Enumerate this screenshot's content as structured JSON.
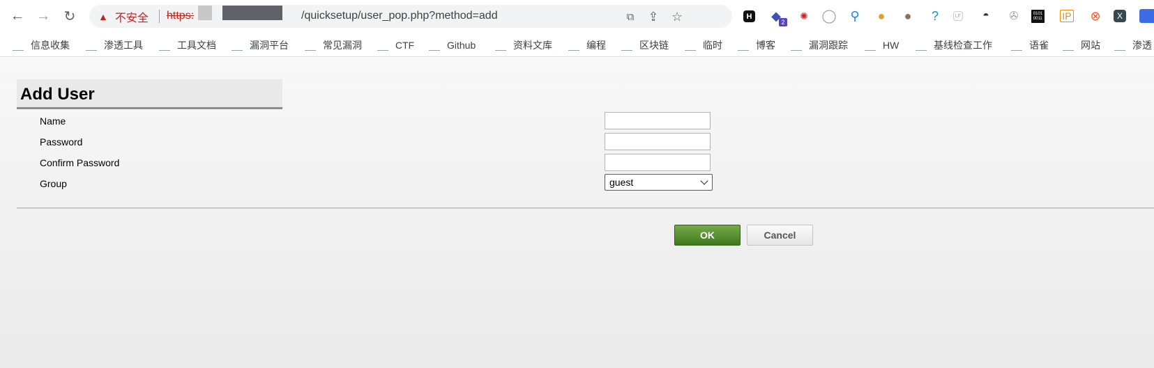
{
  "browser": {
    "security_warning": "不安全",
    "url_scheme": "https:",
    "url_path": "/quicksetup/user_pop.php?method=add",
    "extensions": {
      "hackbar": "H",
      "badge_count": "2",
      "binary_label": "0101\n0011",
      "lf_label": "LF",
      "ip_label": "IP",
      "x_label": "X",
      "help_label": "?"
    },
    "bookmarks": [
      "信息收集",
      "渗透工具",
      "工具文档",
      "漏洞平台",
      "常见漏洞",
      "CTF",
      "Github",
      "资料文库",
      "编程",
      "区块链",
      "临时",
      "博客",
      "漏洞跟踪",
      "HW",
      "基线检查工作",
      "语雀",
      "网站",
      "渗透"
    ]
  },
  "form": {
    "title": "Add User",
    "fields": [
      {
        "label": "Name",
        "value": ""
      },
      {
        "label": "Password",
        "value": ""
      },
      {
        "label": "Confirm Password",
        "value": ""
      }
    ],
    "group_label": "Group",
    "group_value": "guest",
    "ok_label": "OK",
    "cancel_label": "Cancel"
  }
}
